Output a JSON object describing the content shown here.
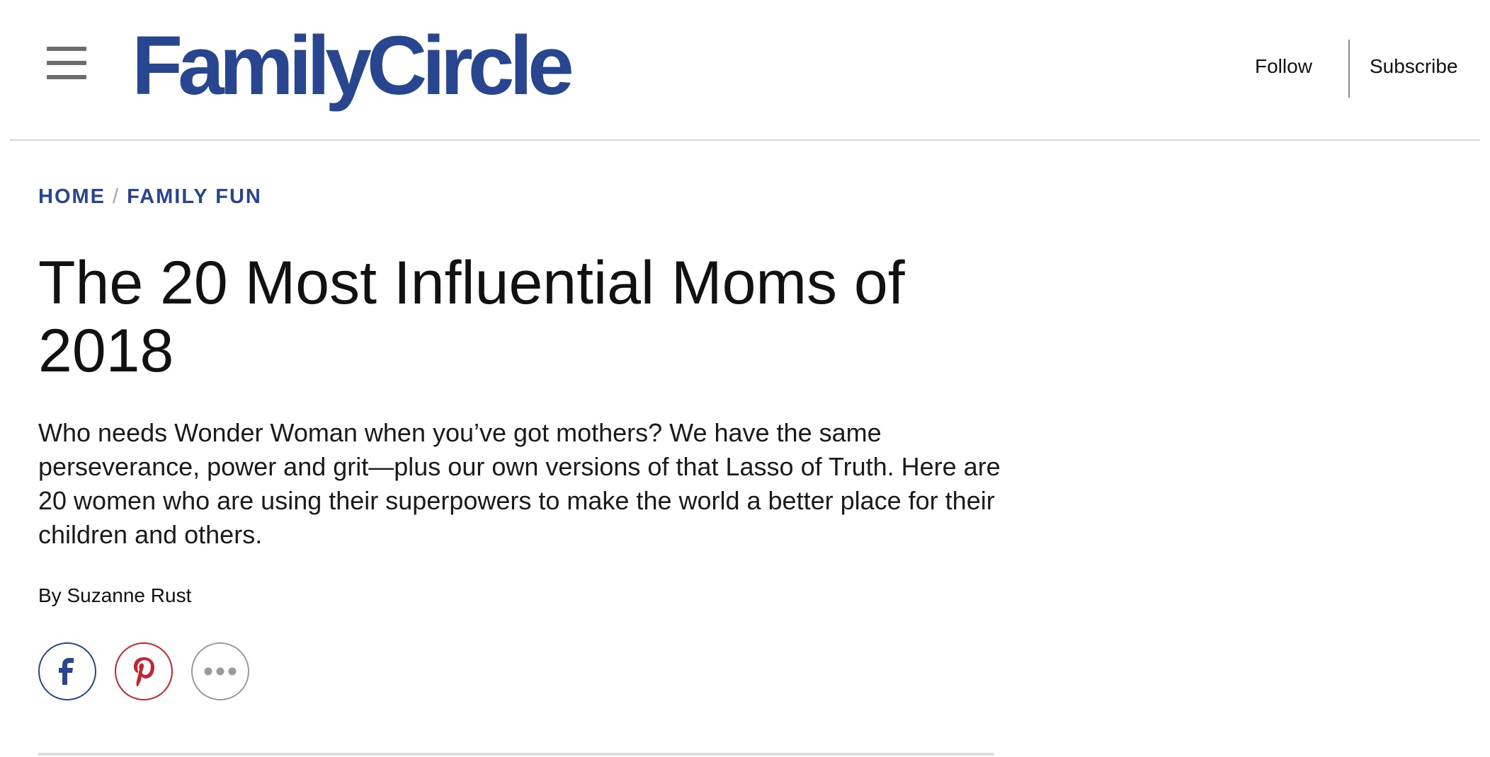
{
  "header": {
    "logo_text": "FamilyCircle",
    "brand_color": "#27468f",
    "menu_icon": "hamburger-menu-icon",
    "follow_label": "Follow",
    "subscribe_label": "Subscribe"
  },
  "breadcrumb": {
    "items": [
      "HOME",
      "FAMILY FUN"
    ],
    "separator": "/"
  },
  "article": {
    "title": "The 20 Most Influential Moms of 2018",
    "dek": "Who needs Wonder Woman when you’ve got mothers? We have the same perseverance, power and grit—plus our own versions of that Lasso of Truth. Here are 20 women who are using their superpowers to make the world a better place for their children and others.",
    "byline": "By Suzanne Rust"
  },
  "social": {
    "buttons": [
      {
        "icon": "facebook-icon",
        "color": "#27468f"
      },
      {
        "icon": "pinterest-icon",
        "color": "#c8232c"
      },
      {
        "icon": "more-dots-icon",
        "color": "#9a9a9a"
      }
    ]
  }
}
